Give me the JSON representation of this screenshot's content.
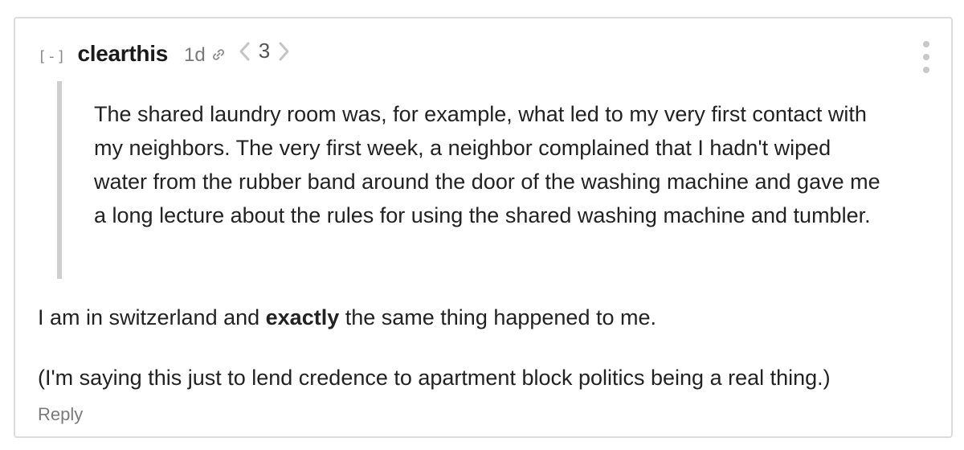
{
  "comment": {
    "collapse_label": "[-]",
    "username": "clearthis",
    "age": "1d",
    "vote_count": "3",
    "quote_text": "The shared laundry room was, for example, what led to my very first contact with my neighbors. The very first week, a neighbor complained that I hadn't wiped water from the rubber band around the door of the washing machine and gave me a long lecture about the rules for using the shared washing machine and tumbler.",
    "body_line1_before": "I am in switzerland and ",
    "body_line1_bold": "exactly",
    "body_line1_after": " the same thing happened to me.",
    "body_line2": "(I'm saying this just to lend credence to apartment block politics being a real thing.)",
    "reply_label": "Reply"
  },
  "icons": {
    "link": "link-icon",
    "prev": "chevron-left-icon",
    "next": "chevron-right-icon",
    "more": "more-vertical-icon"
  },
  "colors": {
    "border": "#dcdcdc",
    "quote_bar": "#cfcfcf",
    "muted": "#7a7a7a",
    "text": "#222222"
  }
}
